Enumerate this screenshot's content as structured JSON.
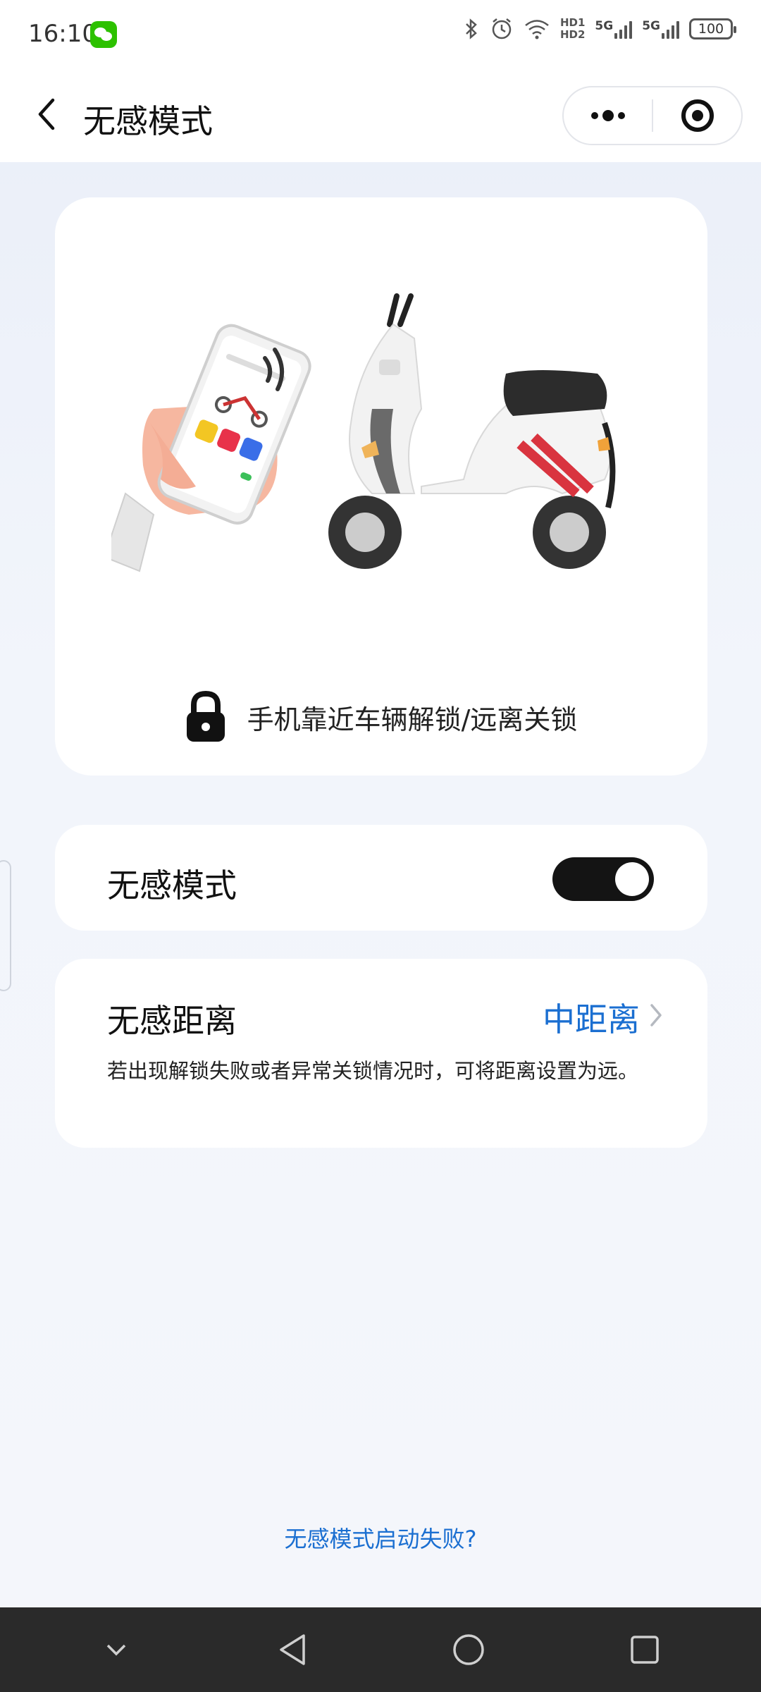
{
  "status_bar": {
    "time": "16:10",
    "hd1": "HD1",
    "hd2": "HD2",
    "sim1": "5G",
    "sim2": "5G",
    "battery": "100"
  },
  "header": {
    "title": "无感模式"
  },
  "hero": {
    "caption": "手机靠近车辆解锁/远离关锁"
  },
  "toggle_card": {
    "label": "无感模式",
    "enabled": true
  },
  "distance_card": {
    "label": "无感距离",
    "value": "中距离",
    "description": "若出现解锁失败或者异常关锁情况时，可将距离设置为远。"
  },
  "footer": {
    "help_link": "无感模式启动失败?"
  },
  "colors": {
    "accent": "#1b6fd1",
    "switch_on": "#141414",
    "page_bg": "#eef2f9"
  }
}
